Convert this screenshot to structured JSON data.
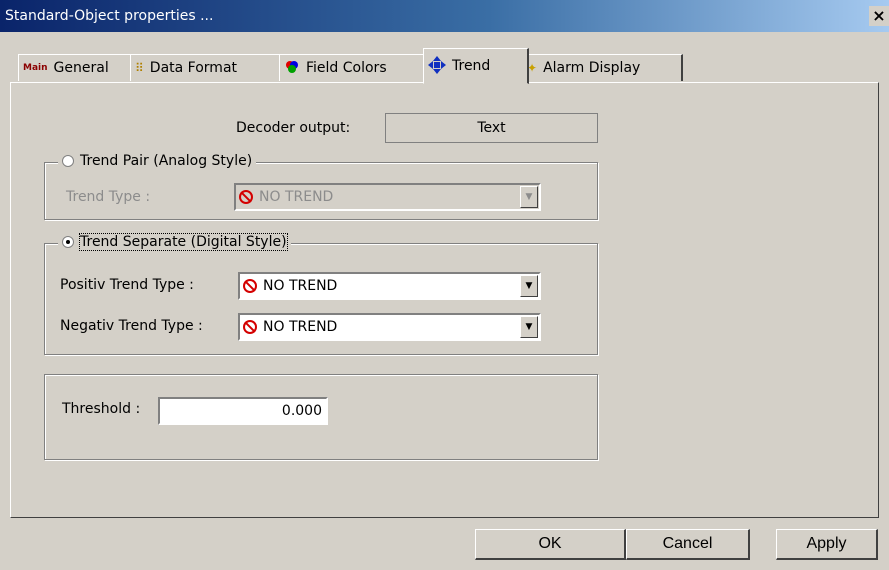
{
  "window": {
    "title": "Standard-Object properties ...",
    "close_glyph": "×"
  },
  "tabs": [
    {
      "label": "General",
      "icon": "main-icon",
      "icon_text": "Main"
    },
    {
      "label": "Data Format",
      "icon": "data-format-icon"
    },
    {
      "label": "Field Colors",
      "icon": "field-colors-icon"
    },
    {
      "label": "Trend",
      "icon": "trend-icon",
      "active": true
    },
    {
      "label": "Alarm Display",
      "icon": "alarm-display-icon"
    }
  ],
  "decoder": {
    "label": "Decoder output:",
    "value": "Text"
  },
  "trend_pair": {
    "legend": "Trend Pair (Analog Style)",
    "type_label": "Trend Type :",
    "type_value": "NO TREND",
    "selected": false,
    "enabled": false
  },
  "trend_separate": {
    "legend": "Trend Separate (Digital Style)",
    "selected": true,
    "positive_label": "Positiv Trend Type :",
    "positive_value": "NO TREND",
    "negative_label": "Negativ Trend Type :",
    "negative_value": "NO TREND"
  },
  "threshold": {
    "label": "Threshold :",
    "value": "0.000"
  },
  "buttons": {
    "ok": "OK",
    "cancel": "Cancel",
    "apply": "Apply"
  }
}
